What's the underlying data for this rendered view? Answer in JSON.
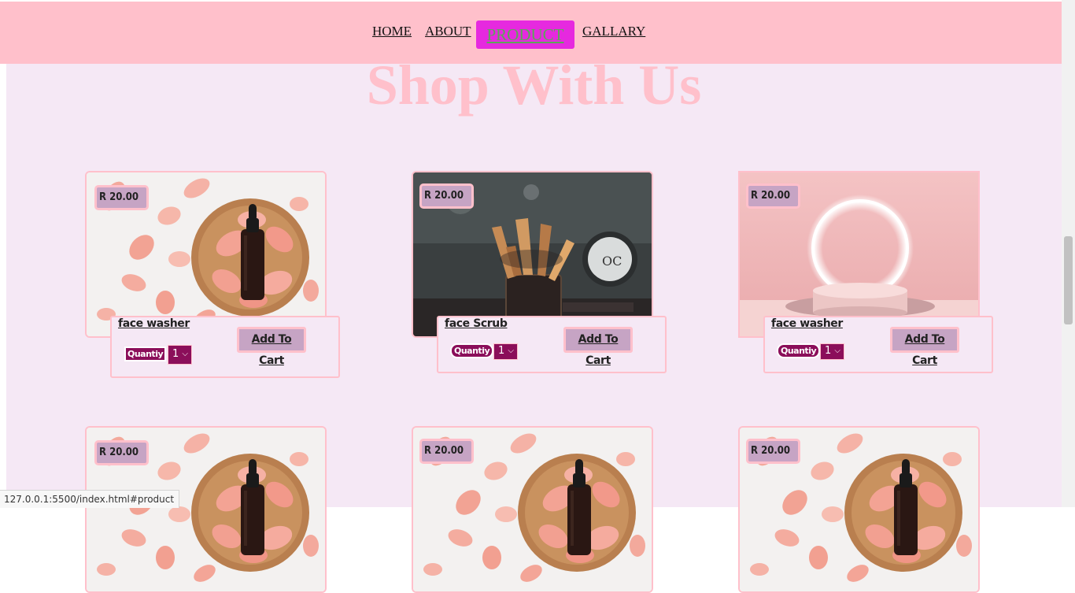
{
  "nav": {
    "home": "HOME",
    "about": "ABOUT",
    "product": "PRODUCT",
    "gallery": "GALLARY"
  },
  "heading": "Shop With Us",
  "products": [
    {
      "price": "R 20.00",
      "name": "face washer",
      "qty_label": "Quantiy",
      "qty_value": "1",
      "cart": "Add To Cart",
      "image": "rose-petals-serum"
    },
    {
      "price": "R 20.00",
      "name": "face Scrub",
      "qty_label": "Quantiy",
      "qty_value": "1",
      "cart": "Add To Cart",
      "image": "makeup-brushes"
    },
    {
      "price": "R 20.00",
      "name": "face washer",
      "qty_label": "Quantiy",
      "qty_value": "1",
      "cart": "Add To Cart",
      "image": "pink-ring-light-podium"
    },
    {
      "price": "R 20.00",
      "image": "rose-petals-serum"
    },
    {
      "price": "R 20.00",
      "image": "rose-petals-serum"
    },
    {
      "price": "R 20.00",
      "image": "rose-petals-serum"
    }
  ],
  "status_url": "127.0.0.1:5500/index.html#product",
  "colors": {
    "page_bg": "#f5e8f5",
    "nav_bg": "#ffc0cb",
    "active_nav": "#e629df",
    "heading": "#ffc0cb",
    "price_bg": "#c6a4c4",
    "quantity_bg": "#8b0e5a"
  }
}
